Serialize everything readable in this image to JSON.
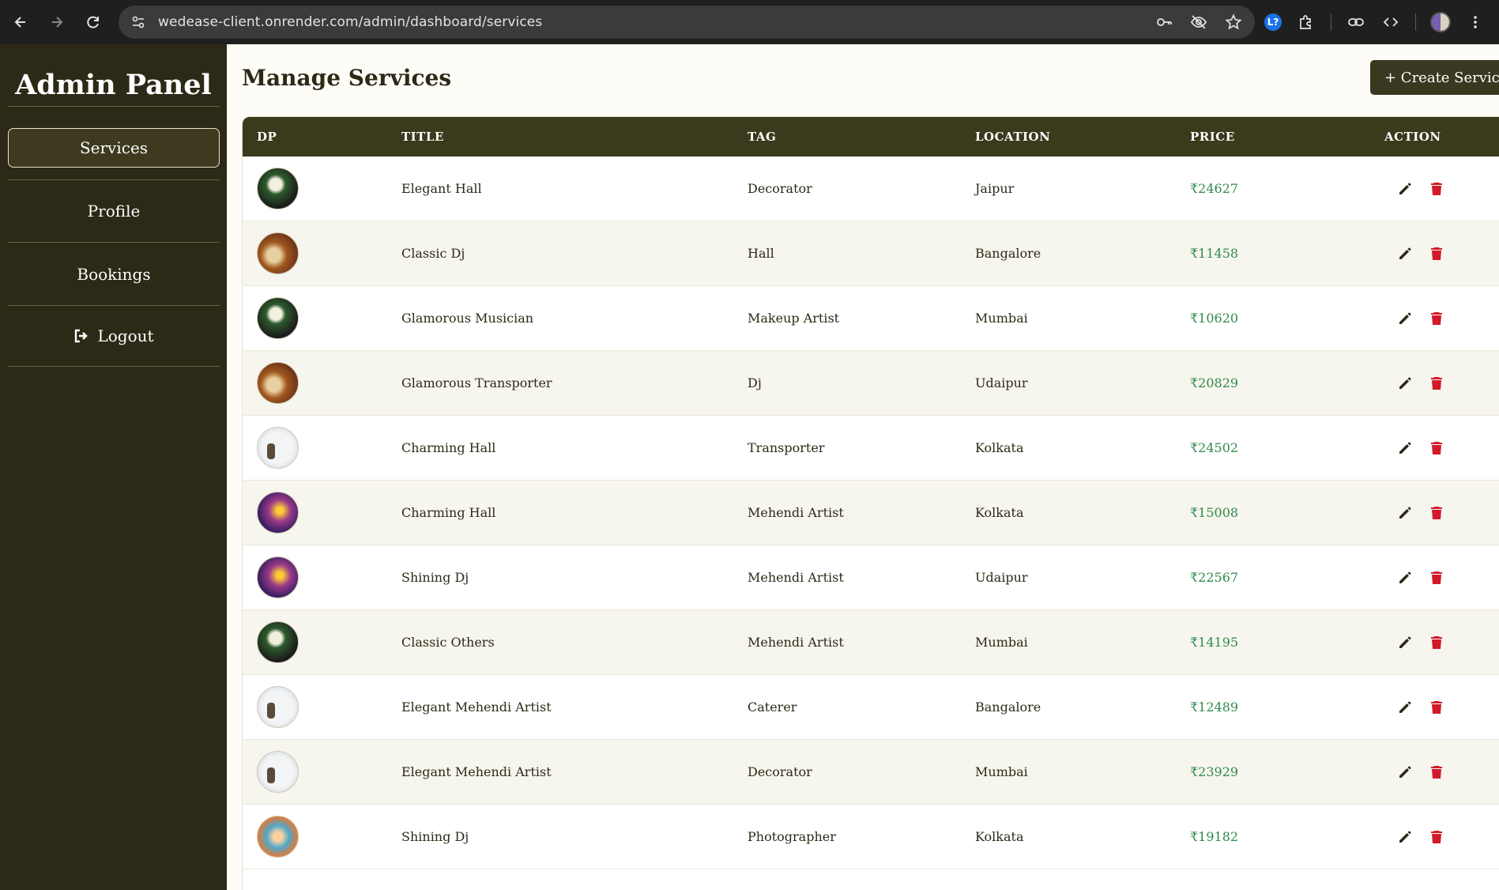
{
  "browser": {
    "url": "wedease-client.onrender.com/admin/dashboard/services",
    "extension_badge": "L?"
  },
  "sidebar": {
    "title": "Admin Panel",
    "items": [
      {
        "label": "Services",
        "active": true
      },
      {
        "label": "Profile",
        "active": false
      },
      {
        "label": "Bookings",
        "active": false
      },
      {
        "label": "Logout",
        "active": false,
        "icon": "logout-icon"
      }
    ]
  },
  "header": {
    "title": "Manage Services",
    "create_label": "+ Create Service"
  },
  "table": {
    "columns": [
      "DP",
      "TITLE",
      "TAG",
      "LOCATION",
      "PRICE",
      "ACTION"
    ],
    "rows": [
      {
        "dp": "type-a",
        "title": "Elegant Hall",
        "tag": "Decorator",
        "location": "Jaipur",
        "price": "₹24627"
      },
      {
        "dp": "type-b",
        "title": "Classic Dj",
        "tag": "Hall",
        "location": "Bangalore",
        "price": "₹11458"
      },
      {
        "dp": "type-a",
        "title": "Glamorous Musician",
        "tag": "Makeup Artist",
        "location": "Mumbai",
        "price": "₹10620"
      },
      {
        "dp": "type-b",
        "title": "Glamorous Transporter",
        "tag": "Dj",
        "location": "Udaipur",
        "price": "₹20829"
      },
      {
        "dp": "type-c",
        "title": "Charming Hall",
        "tag": "Transporter",
        "location": "Kolkata",
        "price": "₹24502"
      },
      {
        "dp": "type-d",
        "title": "Charming Hall",
        "tag": "Mehendi Artist",
        "location": "Kolkata",
        "price": "₹15008"
      },
      {
        "dp": "type-d",
        "title": "Shining Dj",
        "tag": "Mehendi Artist",
        "location": "Udaipur",
        "price": "₹22567"
      },
      {
        "dp": "type-a",
        "title": "Classic Others",
        "tag": "Mehendi Artist",
        "location": "Mumbai",
        "price": "₹14195"
      },
      {
        "dp": "type-c",
        "title": "Elegant Mehendi Artist",
        "tag": "Caterer",
        "location": "Bangalore",
        "price": "₹12489"
      },
      {
        "dp": "type-c",
        "title": "Elegant Mehendi Artist",
        "tag": "Decorator",
        "location": "Mumbai",
        "price": "₹23929"
      },
      {
        "dp": "type-e",
        "title": "Shining Dj",
        "tag": "Photographer",
        "location": "Kolkata",
        "price": "₹19182"
      }
    ]
  },
  "colors": {
    "sidebar_bg": "#2c2a16",
    "header_bg": "#3a3a1c",
    "price": "#2f8a4a",
    "delete": "#d11a2a"
  }
}
